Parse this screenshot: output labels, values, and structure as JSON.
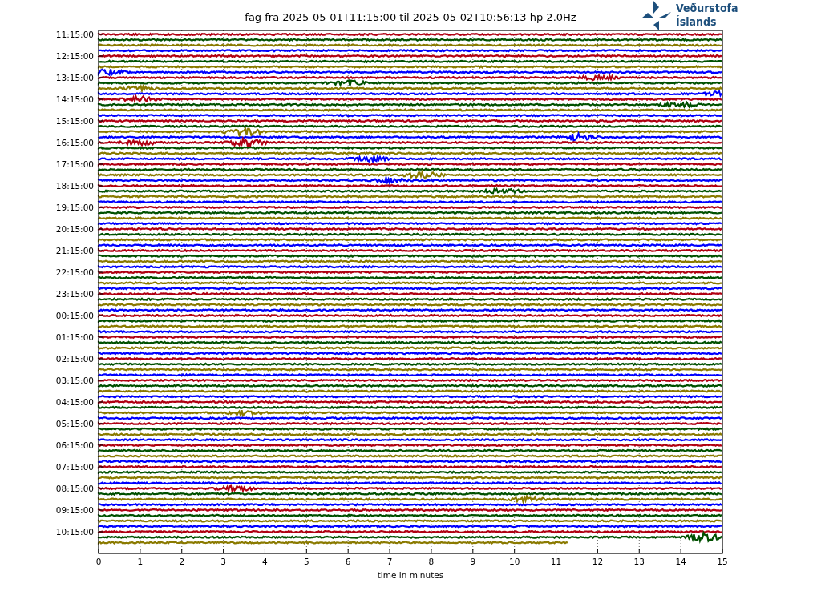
{
  "title": "fag fra 2025-05-01T11:15:00 til 2025-05-02T10:56:13 hp 2.0Hz",
  "logo": {
    "lines": [
      "Veðurstofa",
      "Íslands"
    ]
  },
  "y_tick_labels": [
    "11:15:00",
    "12:15:00",
    "13:15:00",
    "14:15:00",
    "15:15:00",
    "16:15:00",
    "17:15:00",
    "18:15:00",
    "19:15:00",
    "20:15:00",
    "21:15:00",
    "22:15:00",
    "23:15:00",
    "00:15:00",
    "01:15:00",
    "02:15:00",
    "03:15:00",
    "04:15:00",
    "05:15:00",
    "06:15:00",
    "07:15:00",
    "08:15:00",
    "09:15:00",
    "10:15:00"
  ],
  "x_ticks": [
    "0",
    "1",
    "2",
    "3",
    "4",
    "5",
    "6",
    "7",
    "8",
    "9",
    "10",
    "11",
    "12",
    "13",
    "14",
    "15"
  ],
  "xlabel": "time in minutes",
  "trace_colors": [
    {
      "color": "#b00012"
    },
    {
      "color": "#005000"
    },
    {
      "color": "#8a7a00"
    },
    {
      "color": "#0000ff"
    }
  ]
}
